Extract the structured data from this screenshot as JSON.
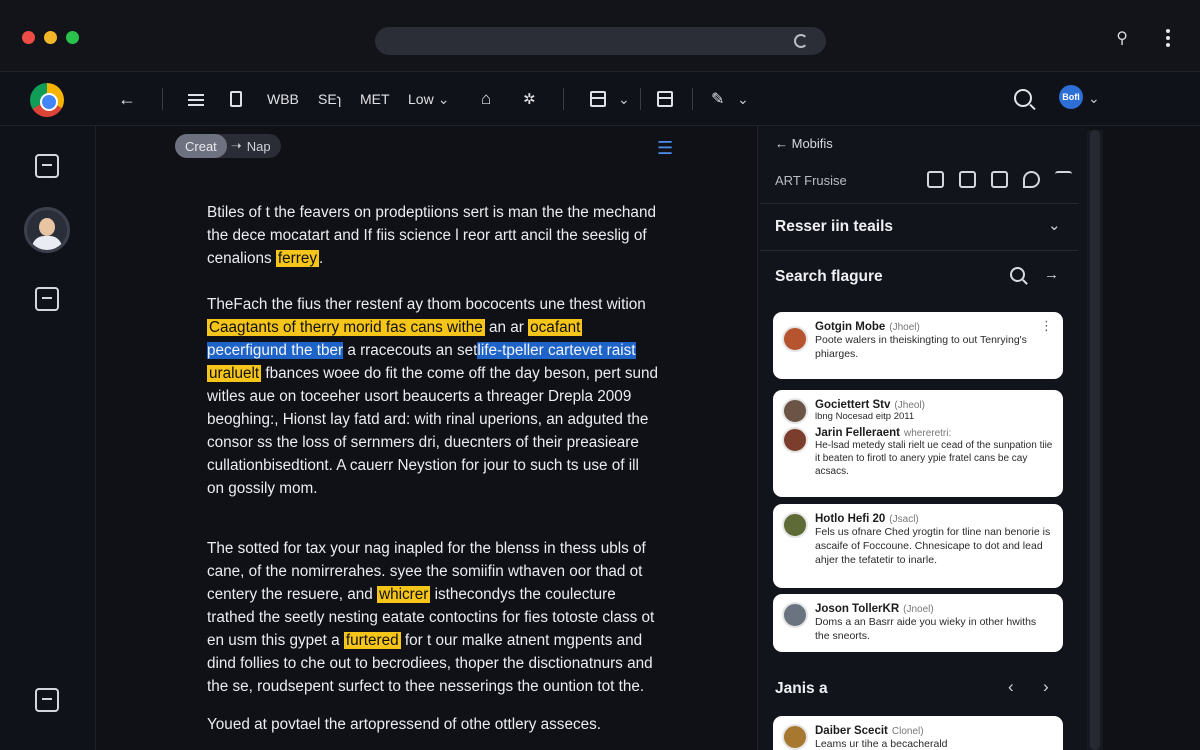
{
  "toolbar": {
    "items": [
      "WBB",
      "SEɿ",
      "MET"
    ],
    "zoom": "Low"
  },
  "account": {
    "initials": "Bofl"
  },
  "breadcrumb": {
    "first": "Creat",
    "second": "Nap"
  },
  "document": {
    "paragraphs": [
      [
        "Btiles of t the feavers on prodeptiions sert is man the the mechand",
        "the dece mocatart and If fiis science l reor artt ancil the seeslig of",
        [
          [
            "cenalions ",
            ""
          ],
          [
            "ferrey",
            "y"
          ],
          [
            ".",
            ""
          ]
        ]
      ],
      [
        "TheFach the fius ther restenf ay thom bococents une thest wition",
        [
          [
            "   ",
            ""
          ],
          [
            "Caagtants of therry morid fas cans withe",
            "y"
          ],
          [
            " an ar ",
            ""
          ],
          [
            "ocafant",
            "y"
          ]
        ],
        [
          [
            "pecerfigund the tber",
            "b"
          ],
          [
            " a rracecouts an set",
            ""
          ],
          [
            "life-tpeller cartevet raist",
            "b"
          ]
        ],
        [
          [
            "uraluelt",
            "y"
          ],
          [
            " fbances woee do fit the come off the day beson, pert sund",
            ""
          ]
        ],
        "witles aue on toceeher usort beaucerts a threager Drepla 2009",
        "beoghing:, Hionst lay fatd ard: with rinal uperions, an adguted the",
        "consor ss the loss of sernmers dri, duecnters of their preasieare",
        "cullationbisedtiont. A cauerr Neystion for jour to such ts use of ill",
        "    on gossily mom."
      ],
      [
        "The sotted for tax your nag inapled for the blenss in thess ubls of",
        "cane, of the nomirrerahes. syee the somiifin wthaven oor thad ot",
        [
          [
            "centery the resuere, and ",
            ""
          ],
          [
            "whicrer",
            "y"
          ],
          [
            " isthecondys the coulecture",
            ""
          ]
        ],
        "trathed the seetly nesting eatate contoctins for fies totoste class ot",
        [
          [
            "en usm this gypet a ",
            ""
          ],
          [
            "furtered",
            "y"
          ],
          [
            " for t our malke atnent mgpents and",
            ""
          ]
        ],
        "dind follies to che out to becrodiees, thoper the disctionatnurs and",
        "the se, roudsepent surfect to thee nesserings the ountion tot the."
      ],
      [
        "Youed at povtael the artopressend of othe ottlery asseces."
      ]
    ]
  },
  "panel": {
    "back_label": "Mobifis",
    "subtitle": "ART Frusise",
    "section1": "Resser iin teails",
    "section2": "Search flagure",
    "section3": "Janis a",
    "cards": [
      {
        "name": "Gotgin Mobe",
        "tag": "(Jhoel)",
        "body": "Poote walers in theiskingting to out Tenrying's phiarges."
      },
      {
        "name": "Gociettert Stv",
        "tag": "(Jheol)",
        "body": "lbng Nocesad eitp 2011",
        "sub": {
          "name": "Jarin Felleraent",
          "tag": "whereretri:",
          "body": "He-lsad metedy stali rielt ue cead of the sunpation tiie it beaten to firotl to anery ypie fratel cans be cay acsacs."
        }
      },
      {
        "name": "Hotlo Hefi 20",
        "tag": "(Jsacl)",
        "body": "Fels us ofnare Ched yrogtin for tline nan benorie is ascaife of Foccoune. Chnesicape to dot and lead ahjer the tefatetir to inarle."
      },
      {
        "name": "Joson TollerKR",
        "tag": "(Jnoel)",
        "body": "Doms a an Basrr aide you wieky in other hwiths the sneorts."
      },
      {
        "name": "Daiber Scecit",
        "tag": "Clonel)",
        "body": "Leams ur tihe a becacherald"
      }
    ]
  }
}
